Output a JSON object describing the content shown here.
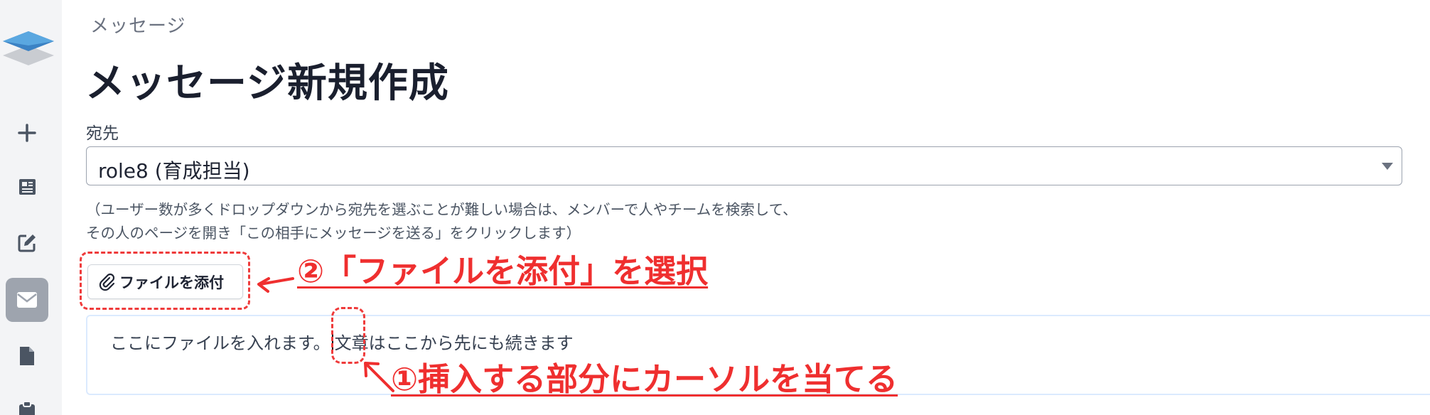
{
  "sidebar": {
    "icons": [
      {
        "name": "logo-icon"
      },
      {
        "name": "plus-icon"
      },
      {
        "name": "newspaper-icon"
      },
      {
        "name": "edit-icon"
      },
      {
        "name": "envelope-icon"
      },
      {
        "name": "file-icon"
      },
      {
        "name": "clipboard-icon"
      }
    ],
    "active_item": "envelope-icon"
  },
  "breadcrumb": "メッセージ",
  "page_title": "メッセージ新規作成",
  "recipient": {
    "label": "宛先",
    "selected_value": "role8 (育成担当)"
  },
  "help_text": [
    "（ユーザー数が多くドロップダウンから宛先を選ぶことが難しい場合は、メンバーで人やチームを検索して、",
    "その人のページを開き「この相手にメッセージを送る」をクリックします）"
  ],
  "attach_button": {
    "label": "ファイルを添付"
  },
  "editor": {
    "text_before_cursor": "ここにファイルを入れます。",
    "text_after_cursor": "文章はここから先にも続きます"
  },
  "annotations": {
    "step2": "②「ファイルを添付」を選択",
    "step1": "①挿入する部分にカーソルを当てる",
    "color": "#ef2f2f"
  }
}
